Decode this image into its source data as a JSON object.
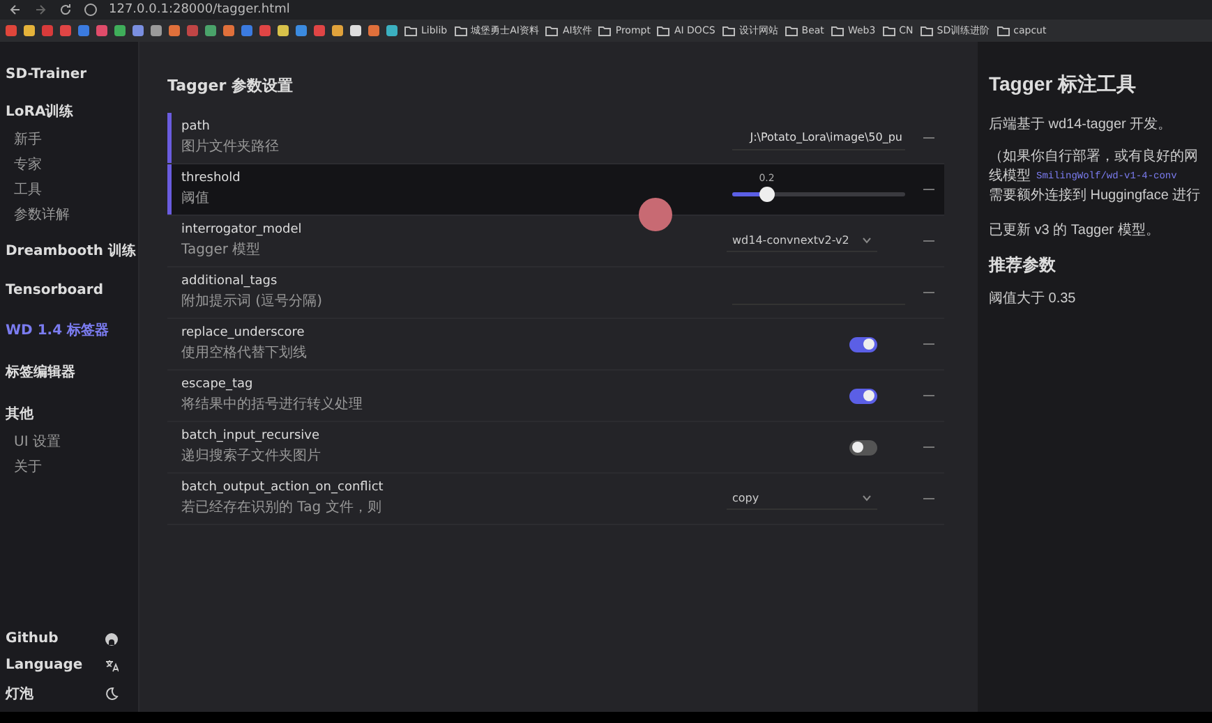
{
  "browser": {
    "url": "127.0.0.1:28000/tagger.html",
    "bookmarks": [
      {
        "label": "Liblib"
      },
      {
        "label": "城堡勇士AI资料"
      },
      {
        "label": "AI软件"
      },
      {
        "label": "Prompt"
      },
      {
        "label": "AI DOCS"
      },
      {
        "label": "设计网站"
      },
      {
        "label": "Beat"
      },
      {
        "label": "Web3"
      },
      {
        "label": "CN"
      },
      {
        "label": "SD训练进阶"
      },
      {
        "label": "capcut"
      }
    ],
    "bookmark_icons": [
      {
        "color": "#e0463b"
      },
      {
        "color": "#e5b33a"
      },
      {
        "color": "#d93b3b"
      },
      {
        "color": "#e04545"
      },
      {
        "color": "#3b7be0"
      },
      {
        "color": "#e04c6a"
      },
      {
        "color": "#3fae5a"
      },
      {
        "color": "#7a8fe0"
      },
      {
        "color": "#9a9a9a"
      },
      {
        "color": "#e0703b"
      },
      {
        "color": "#c04545"
      },
      {
        "color": "#4aa36a"
      },
      {
        "color": "#e0703b"
      },
      {
        "color": "#3b7be0"
      },
      {
        "color": "#e04545"
      },
      {
        "color": "#d8c24a"
      },
      {
        "color": "#3b8be0"
      },
      {
        "color": "#e04545"
      },
      {
        "color": "#e0a23b"
      },
      {
        "color": "#dddddd"
      },
      {
        "color": "#e0703b"
      },
      {
        "color": "#3bb0c0"
      }
    ]
  },
  "sidebar": {
    "title": "SD-Trainer",
    "items": [
      {
        "label": "LoRA训练",
        "kind": "group",
        "selected": false,
        "children": [
          {
            "label": "新手",
            "selected": false
          },
          {
            "label": "专家",
            "selected": false
          },
          {
            "label": "工具",
            "selected": false
          },
          {
            "label": "参数详解",
            "selected": false
          }
        ]
      },
      {
        "label": "Dreambooth 训练",
        "kind": "link",
        "selected": false
      },
      {
        "label": "Tensorboard",
        "kind": "link",
        "selected": false
      },
      {
        "label": "WD 1.4 标签器",
        "kind": "link",
        "selected": true
      },
      {
        "label": "标签编辑器",
        "kind": "link",
        "selected": false
      },
      {
        "label": "其他",
        "kind": "group",
        "selected": false,
        "children": [
          {
            "label": "UI 设置",
            "selected": false
          },
          {
            "label": "关于",
            "selected": false
          }
        ]
      }
    ],
    "footer": [
      {
        "label": "Github",
        "kind": "github"
      },
      {
        "label": "Language",
        "kind": "language"
      },
      {
        "label": "灯泡",
        "kind": "theme"
      }
    ]
  },
  "settings": {
    "title": "Tagger 参数设置",
    "rows": [
      {
        "name": "path",
        "description": "图片文件夹路径",
        "kind": "text",
        "value": "J:\\Potato_Lora\\image\\50_pu",
        "focused": true,
        "hovered": false
      },
      {
        "name": "threshold",
        "description": "阈值",
        "kind": "slider",
        "reading": "0.2",
        "level": 0.2,
        "focused": true,
        "hovered": true
      },
      {
        "name": "interrogator_model",
        "description": "Tagger 模型",
        "kind": "select",
        "value": "wd14-convnextv2-v2",
        "focused": false,
        "hovered": false
      },
      {
        "name": "additional_tags",
        "description": "附加提示词 (逗号分隔)",
        "kind": "text",
        "value": "",
        "focused": false,
        "hovered": false
      },
      {
        "name": "replace_underscore",
        "description": "使用空格代替下划线",
        "kind": "toggle",
        "on": true,
        "focused": false,
        "hovered": false
      },
      {
        "name": "escape_tag",
        "description": "将结果中的括号进行转义处理",
        "kind": "toggle",
        "on": true,
        "focused": false,
        "hovered": false
      },
      {
        "name": "batch_input_recursive",
        "description": "递归搜索子文件夹图片",
        "kind": "toggle",
        "on": false,
        "focused": false,
        "hovered": false
      },
      {
        "name": "batch_output_action_on_conflict",
        "description": "若已经存在识别的 Tag 文件，则",
        "kind": "select",
        "value": "copy",
        "focused": false,
        "hovered": false
      }
    ]
  },
  "info": {
    "title": "Tagger 标注工具",
    "paragraphs": [
      {
        "kind": "text",
        "text": "后端基于 wd14-tagger 开发。"
      },
      {
        "kind": "note",
        "lines": [
          {
            "text": "（如果你自行部署，或有良好的网"
          },
          {
            "text": "线模型",
            "link": "SmilingWolf/wd-v1-4-conv"
          },
          {
            "text": "需要额外连接到 Huggingface 进行"
          }
        ]
      },
      {
        "kind": "text",
        "text": "已更新 v3 的 Tagger 模型。"
      },
      {
        "kind": "heading",
        "text": "推荐参数"
      },
      {
        "kind": "text",
        "text": "阈值大于 0.35"
      }
    ]
  }
}
